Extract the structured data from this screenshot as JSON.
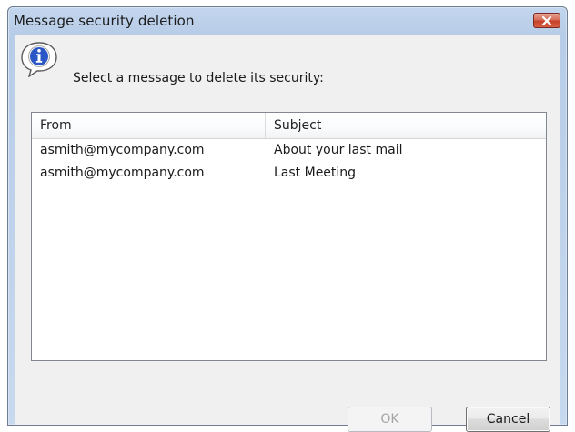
{
  "window": {
    "title": "Message security deletion"
  },
  "prompt": {
    "text": "Select a message to delete its security:",
    "icon": "info-icon"
  },
  "list": {
    "columns": {
      "from": "From",
      "subject": "Subject"
    },
    "rows": [
      {
        "from": "asmith@mycompany.com",
        "subject": "About your last mail"
      },
      {
        "from": "asmith@mycompany.com",
        "subject": "Last Meeting"
      }
    ]
  },
  "buttons": {
    "ok": "OK",
    "cancel": "Cancel",
    "ok_enabled": false
  },
  "colors": {
    "title_bar": "#b7cce7",
    "close_button": "#c7422a",
    "client_background": "#f0f0f0"
  }
}
